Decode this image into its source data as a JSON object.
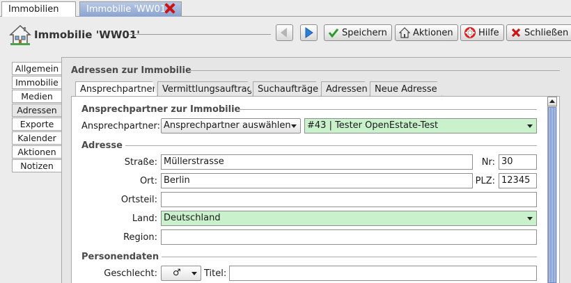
{
  "doc_tabs": [
    {
      "label": "Immobilien",
      "active": false
    },
    {
      "label": "Immobilie 'WW01'",
      "active": true
    }
  ],
  "header": {
    "title": "Immobilie 'WW01'",
    "buttons": {
      "save": "Speichern",
      "actions": "Aktionen",
      "help": "Hilfe",
      "close": "Schließen"
    }
  },
  "sidebar": {
    "items": [
      {
        "label": "Allgemein"
      },
      {
        "label": "Immobilie"
      },
      {
        "label": "Medien"
      },
      {
        "label": "Adressen"
      },
      {
        "label": "Exporte"
      },
      {
        "label": "Kalender"
      },
      {
        "label": "Aktionen"
      },
      {
        "label": "Notizen"
      }
    ],
    "selected": "Adressen"
  },
  "main": {
    "section_title": "Adressen zur Immobilie",
    "tabs": [
      {
        "label": "Ansprechpartner",
        "active": true
      },
      {
        "label": "Vermittlungsauftrag",
        "active": false
      },
      {
        "label": "Suchaufträge",
        "active": false
      },
      {
        "label": "Adressen",
        "active": false
      },
      {
        "label": "Neue Adresse",
        "active": false
      }
    ],
    "contact_section": {
      "title": "Ansprechpartner zur Immobilie",
      "label": "Ansprechpartner:",
      "select_value": "Ansprechpartner auswählen",
      "selected_contact": "#43 | Tester OpenEstate-Test"
    },
    "address_section": {
      "title": "Adresse",
      "street_label": "Straße:",
      "street_value": "Müllerstrasse",
      "nr_label": "Nr:",
      "nr_value": "30",
      "city_label": "Ort:",
      "city_value": "Berlin",
      "zip_label": "PLZ:",
      "zip_value": "12345",
      "district_label": "Ortsteil:",
      "district_value": "",
      "country_label": "Land:",
      "country_value": "Deutschland",
      "region_label": "Region:",
      "region_value": ""
    },
    "person_section": {
      "title": "Personendaten",
      "gender_label": "Geschlecht:",
      "gender_value": "♂",
      "title_label": "Titel:",
      "title_value": ""
    }
  },
  "colors": {
    "active_tab": "#8aa3cf",
    "green_field": "#c9f2cc",
    "close_red": "#cc1414",
    "nav_blue": "#2a7fd4"
  }
}
